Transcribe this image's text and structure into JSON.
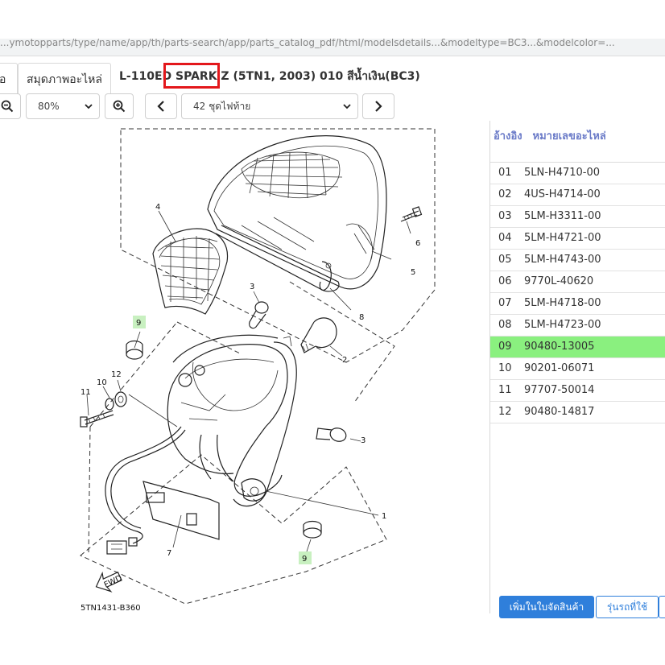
{
  "browser": {
    "url": "...ymotopparts/type/name/app/th/parts-search/app/parts_catalog_pdf/html/modelsdetails...&modeltype=BC3...&modelcolor=..."
  },
  "tabs": [
    {
      "label": "อ"
    },
    {
      "label": "สมุดภาพอะไหล่"
    }
  ],
  "page": {
    "title_prefix": "L-110ED ",
    "title_model": "SPARK Z",
    "title_suffix": " (5TN1, 2003) 010 สีน้ำเงิน(BC3)"
  },
  "toolbar": {
    "zoom_value": "80%",
    "page_value": "42 ชุดไฟท้าย"
  },
  "parts_table": {
    "header_ref": "อ้างอิง",
    "header_part": "หมายเลขอะไหล่",
    "selected_index": 8,
    "rows": [
      {
        "ref": "01",
        "part": "5LN-H4710-00"
      },
      {
        "ref": "02",
        "part": "4US-H4714-00"
      },
      {
        "ref": "03",
        "part": "5LM-H3311-00"
      },
      {
        "ref": "04",
        "part": "5LM-H4721-00"
      },
      {
        "ref": "05",
        "part": "5LM-H4743-00"
      },
      {
        "ref": "06",
        "part": "9770L-40620"
      },
      {
        "ref": "07",
        "part": "5LM-H4718-00"
      },
      {
        "ref": "08",
        "part": "5LM-H4723-00"
      },
      {
        "ref": "09",
        "part": "90480-13005"
      },
      {
        "ref": "10",
        "part": "90201-06071"
      },
      {
        "ref": "11",
        "part": "97707-50014"
      },
      {
        "ref": "12",
        "part": "90480-14817"
      }
    ]
  },
  "buttons": {
    "add_to_cart": "เพิ่มในใบจัดสินค้า",
    "models_used": "รุ่นรถที่ใช้"
  },
  "diagram": {
    "code": "5TN1431-B360",
    "fwd_label": "FWD",
    "callouts": [
      "1",
      "2",
      "3",
      "3",
      "4",
      "5",
      "6",
      "7",
      "8",
      "9",
      "9",
      "10",
      "11",
      "12"
    ]
  }
}
